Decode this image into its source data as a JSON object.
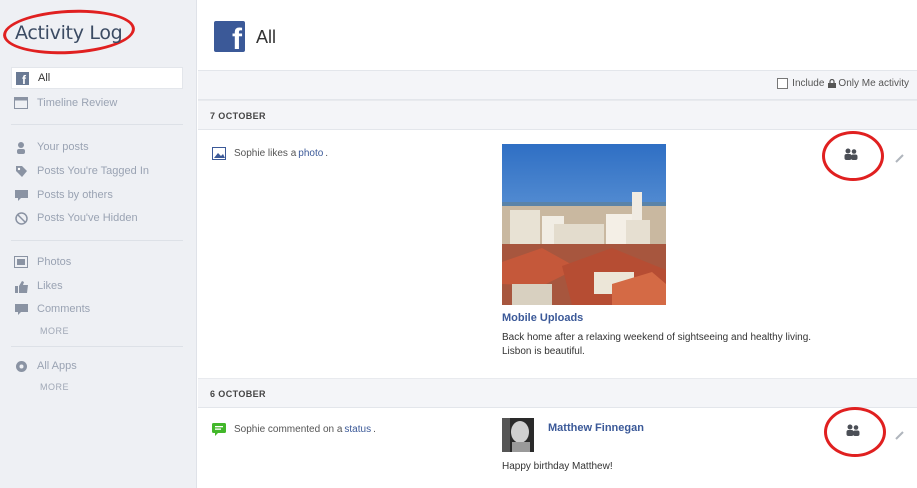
{
  "sidebar": {
    "title": "Activity Log",
    "items": [
      {
        "label": "All",
        "icon": "facebook-icon"
      },
      {
        "label": "Timeline Review",
        "icon": "timeline-icon"
      },
      {
        "label": "Your posts",
        "icon": "person-icon"
      },
      {
        "label": "Posts You're Tagged In",
        "icon": "tag-icon"
      },
      {
        "label": "Posts by others",
        "icon": "speech-bubble-icon"
      },
      {
        "label": "Posts You've Hidden",
        "icon": "hidden-icon"
      },
      {
        "label": "Photos",
        "icon": "photos-icon"
      },
      {
        "label": "Likes",
        "icon": "thumbs-up-icon"
      },
      {
        "label": "Comments",
        "icon": "comment-icon"
      },
      {
        "label": "All Apps",
        "icon": "apps-icon"
      }
    ],
    "more_1": "MORE",
    "more_2": "MORE"
  },
  "header": {
    "logo_letter": "f",
    "title": "All"
  },
  "filter": {
    "include_label": "Include",
    "only_me_label": "Only Me activity"
  },
  "sections": [
    {
      "date": "7 OCTOBER",
      "story_actor": "Sophie likes a",
      "story_link": "photo",
      "story_end": ".",
      "album_title": "Mobile Uploads",
      "caption": "Back home after a relaxing weekend of sightseeing and healthy living. Lisbon is beautiful."
    },
    {
      "date": "6 OCTOBER",
      "story_actor": "Sophie commented on a",
      "story_link": "status",
      "story_end": ".",
      "commenter_name": "Matthew Finnegan",
      "comment_text": "Happy birthday Matthew!"
    }
  ],
  "colors": {
    "brand": "#3b5998",
    "annotation": "#e02020",
    "sidebar_bg": "#eef0f4"
  }
}
